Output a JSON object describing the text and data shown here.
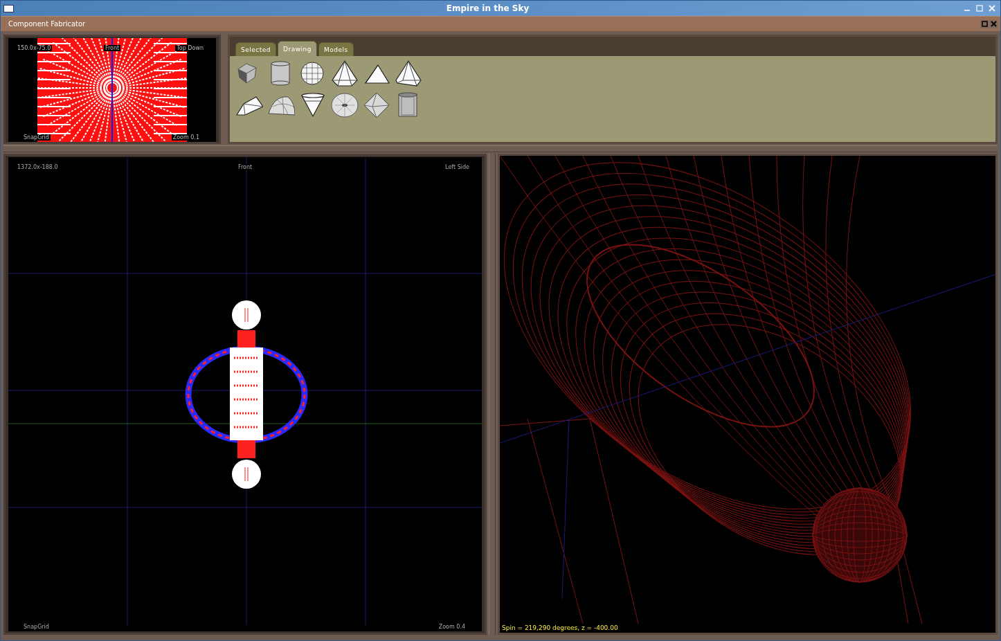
{
  "window": {
    "title": "Empire in the Sky"
  },
  "subwindow": {
    "title": "Component Fabricator"
  },
  "top_view": {
    "kind": "top",
    "coords": "150.0x-75.0",
    "label_center": "Front",
    "label_right": "Top Down",
    "snap": "SnapGrid",
    "zoom": "Zoom 0.1"
  },
  "tabs": [
    {
      "label": "Selected",
      "selected": false
    },
    {
      "label": "Drawing",
      "selected": true
    },
    {
      "label": "Models",
      "selected": false
    }
  ],
  "shapes": [
    {
      "kind": "cube"
    },
    {
      "kind": "cylinder"
    },
    {
      "kind": "sphere"
    },
    {
      "kind": "hex-pyramid"
    },
    {
      "kind": "tetrahedron"
    },
    {
      "kind": "square-pyramid"
    },
    {
      "kind": "wedge"
    },
    {
      "kind": "dome"
    },
    {
      "kind": "cone"
    },
    {
      "kind": "torus"
    },
    {
      "kind": "octahedron"
    },
    {
      "kind": "tube"
    }
  ],
  "front_view": {
    "kind": "front",
    "coords": "1372.0x-188.0",
    "label_center": "Front",
    "label_right": "Left Side",
    "snap": "SnapGrid",
    "zoom": "Zoom 0.4"
  },
  "perspective_view": {
    "status": "Spin = 219,290 degrees, z = -400.00"
  }
}
